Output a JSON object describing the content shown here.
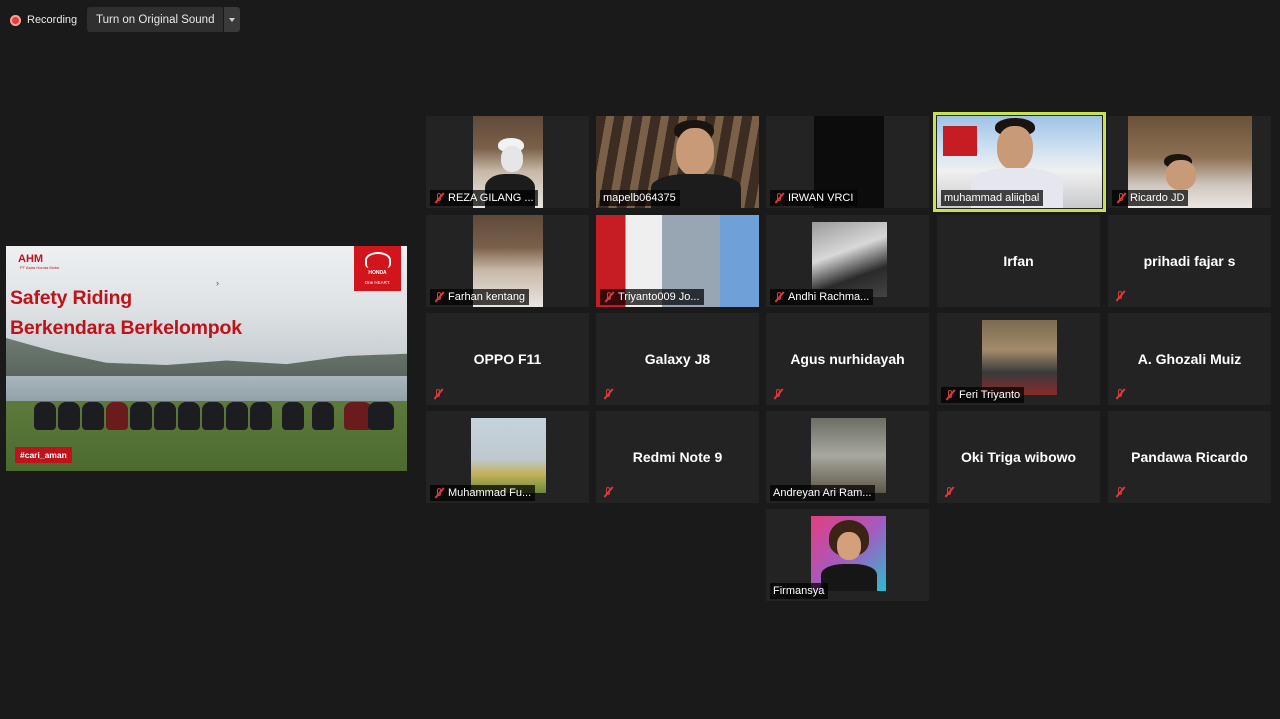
{
  "toolbar": {
    "recording_label": "Recording",
    "sound_button_label": "Turn on Original Sound"
  },
  "slide": {
    "logo_text": "AHM",
    "logo_sub": "PT Astra Honda Motor",
    "brand_text": "HONDA",
    "brand_tagline": "One HEART.",
    "title_line1": "Safety Riding",
    "title_line2": "Berkendara Berkelompok",
    "hashtag": "#cari_aman"
  },
  "participants": [
    {
      "name": "REZA GILANG ...",
      "muted": true,
      "video": true
    },
    {
      "name": "mapelb064375",
      "muted": false,
      "video": true
    },
    {
      "name": "IRWAN VRCI",
      "muted": true,
      "video": true
    },
    {
      "name": "muhammad aliiqbal",
      "muted": false,
      "video": true,
      "active_speaker": true
    },
    {
      "name": "Ricardo JD",
      "muted": true,
      "video": true
    },
    {
      "name": "Farhan kentang",
      "muted": true,
      "video": true
    },
    {
      "name": "Triyanto009 Jo...",
      "muted": true,
      "video": true
    },
    {
      "name": "Andhi Rachma...",
      "muted": true,
      "video": true
    },
    {
      "name": "Irfan",
      "muted": false,
      "video": false
    },
    {
      "name": "prihadi fajar s",
      "muted": true,
      "video": false
    },
    {
      "name": "OPPO F11",
      "muted": true,
      "video": false
    },
    {
      "name": "Galaxy J8",
      "muted": true,
      "video": false
    },
    {
      "name": "Agus nurhidayah",
      "muted": true,
      "video": false
    },
    {
      "name": "Feri Triyanto",
      "muted": true,
      "video": true
    },
    {
      "name": "A. Ghozali Muiz",
      "muted": true,
      "video": false
    },
    {
      "name": "Muhammad Fu...",
      "muted": true,
      "video": true
    },
    {
      "name": "Redmi Note 9",
      "muted": true,
      "video": false
    },
    {
      "name": "Andreyan Ari Ram...",
      "muted": false,
      "video": true
    },
    {
      "name": "Oki Triga wibowo",
      "muted": true,
      "video": false
    },
    {
      "name": "Pandawa Ricardo",
      "muted": true,
      "video": false
    },
    {
      "name": "Firmansya",
      "muted": false,
      "video": true
    }
  ]
}
